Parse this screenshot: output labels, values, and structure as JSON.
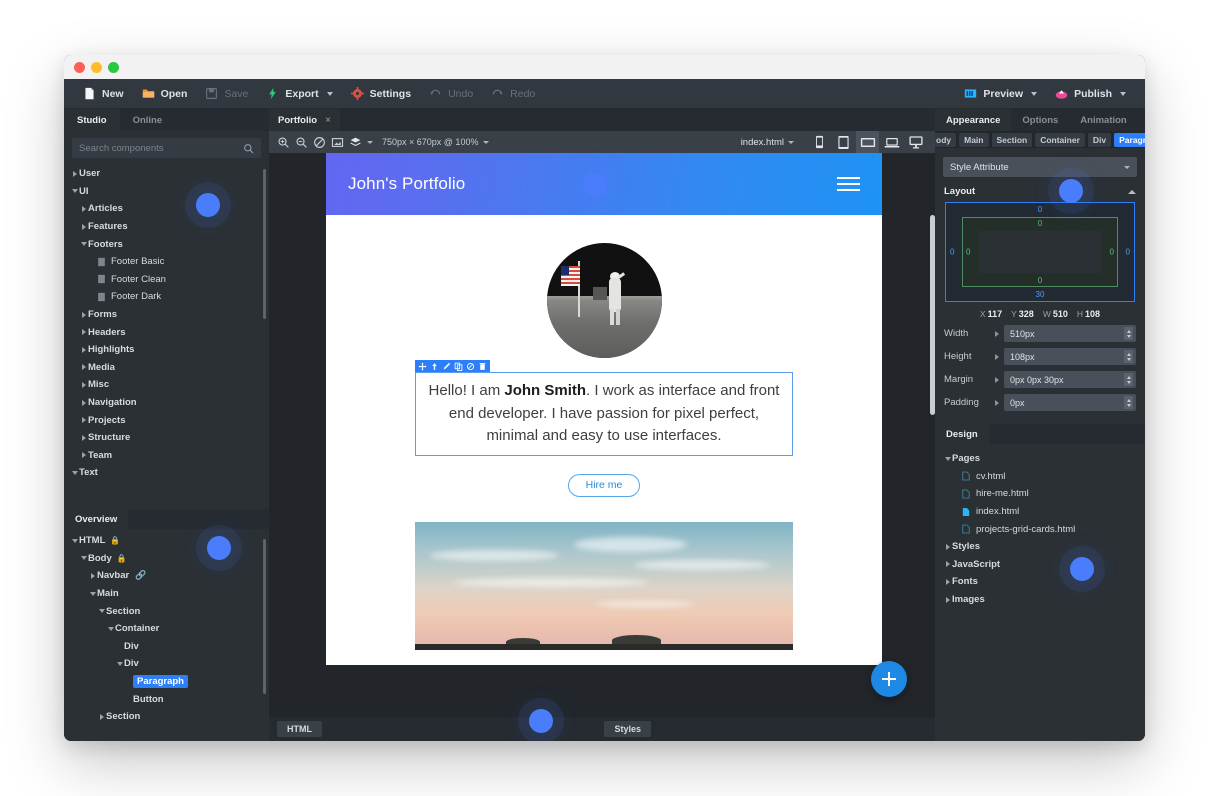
{
  "toolbar": {
    "items": [
      {
        "label": "New",
        "icon": "new-file-icon",
        "disabled": false
      },
      {
        "label": "Open",
        "icon": "open-folder-icon",
        "disabled": false
      },
      {
        "label": "Save",
        "icon": "save-disk-icon",
        "disabled": true
      },
      {
        "label": "Export",
        "icon": "export-bolt-icon",
        "disabled": false,
        "caret": true
      },
      {
        "label": "Settings",
        "icon": "settings-gear-icon",
        "disabled": false
      },
      {
        "label": "Undo",
        "icon": "undo-arrow-icon",
        "disabled": true
      },
      {
        "label": "Redo",
        "icon": "redo-arrow-icon",
        "disabled": true
      }
    ],
    "preview_label": "Preview",
    "publish_label": "Publish"
  },
  "left_panel": {
    "tabs": [
      {
        "label": "Studio",
        "active": true
      },
      {
        "label": "Online",
        "active": false
      }
    ],
    "search": {
      "placeholder": "Search components",
      "value": ""
    },
    "components": [
      {
        "label": "User",
        "depth": 0,
        "twisty": "right",
        "bold": true
      },
      {
        "label": "UI",
        "depth": 0,
        "twisty": "down",
        "bold": true
      },
      {
        "label": "Articles",
        "depth": 1,
        "twisty": "right",
        "bold": true
      },
      {
        "label": "Features",
        "depth": 1,
        "twisty": "right",
        "bold": true
      },
      {
        "label": "Footers",
        "depth": 1,
        "twisty": "down",
        "bold": true
      },
      {
        "label": "Footer Basic",
        "depth": 2,
        "twisty": "none",
        "leaf": true
      },
      {
        "label": "Footer Clean",
        "depth": 2,
        "twisty": "none",
        "leaf": true
      },
      {
        "label": "Footer Dark",
        "depth": 2,
        "twisty": "none",
        "leaf": true
      },
      {
        "label": "Forms",
        "depth": 1,
        "twisty": "right",
        "bold": true
      },
      {
        "label": "Headers",
        "depth": 1,
        "twisty": "right",
        "bold": true
      },
      {
        "label": "Highlights",
        "depth": 1,
        "twisty": "right",
        "bold": true
      },
      {
        "label": "Media",
        "depth": 1,
        "twisty": "right",
        "bold": true
      },
      {
        "label": "Misc",
        "depth": 1,
        "twisty": "right",
        "bold": true
      },
      {
        "label": "Navigation",
        "depth": 1,
        "twisty": "right",
        "bold": true
      },
      {
        "label": "Projects",
        "depth": 1,
        "twisty": "right",
        "bold": true
      },
      {
        "label": "Structure",
        "depth": 1,
        "twisty": "right",
        "bold": true
      },
      {
        "label": "Team",
        "depth": 1,
        "twisty": "right",
        "bold": true
      },
      {
        "label": "Text",
        "depth": 0,
        "twisty": "down",
        "bold": true
      }
    ],
    "overview_tab": "Overview",
    "dom_tree": [
      {
        "label": "HTML",
        "depth": 0,
        "twisty": "down",
        "bold": true,
        "lock": true
      },
      {
        "label": "Body",
        "depth": 1,
        "twisty": "down",
        "bold": true,
        "lock": true
      },
      {
        "label": "Navbar",
        "depth": 2,
        "twisty": "right",
        "bold": true,
        "link": true
      },
      {
        "label": "Main",
        "depth": 2,
        "twisty": "down",
        "bold": true
      },
      {
        "label": "Section",
        "depth": 3,
        "twisty": "down",
        "bold": true
      },
      {
        "label": "Container",
        "depth": 4,
        "twisty": "down",
        "bold": true
      },
      {
        "label": "Div",
        "depth": 5,
        "twisty": "none",
        "bold": true
      },
      {
        "label": "Div",
        "depth": 5,
        "twisty": "down",
        "bold": true
      },
      {
        "label": "Paragraph",
        "depth": 6,
        "twisty": "none",
        "bold": true,
        "selected": true
      },
      {
        "label": "Button",
        "depth": 6,
        "twisty": "none",
        "bold": true
      },
      {
        "label": "Section",
        "depth": 3,
        "twisty": "right",
        "bold": true
      }
    ]
  },
  "center": {
    "doc_tab": {
      "label": "Portfolio",
      "close": "×"
    },
    "canvas_tools": [
      {
        "icon": "zoom-in-icon"
      },
      {
        "icon": "zoom-out-icon"
      },
      {
        "icon": "no-style-icon"
      },
      {
        "icon": "fit-screen-icon"
      },
      {
        "icon": "layers-icon",
        "caret": true
      }
    ],
    "canvas_size_label": "750px × 670px @ 100%",
    "page_select": "index.html",
    "devices": [
      {
        "icon": "phone-icon",
        "active": false
      },
      {
        "icon": "tablet-icon",
        "active": false
      },
      {
        "icon": "small-screen-icon",
        "active": true
      },
      {
        "icon": "laptop-icon",
        "active": false
      },
      {
        "icon": "desktop-icon",
        "active": false
      }
    ],
    "preview": {
      "site_title": "John's Portfolio",
      "paragraph_pre": "Hello! I am ",
      "paragraph_name": "John Smith",
      "paragraph_post": ". I work as interface and front end developer. I have passion for pixel perfect, minimal and easy to use interfaces.",
      "hire_button": "Hire me"
    },
    "selection_toolbar": [
      {
        "icon": "move-icon"
      },
      {
        "icon": "select-parent-arrow-icon"
      },
      {
        "icon": "edit-pencil-icon"
      },
      {
        "icon": "duplicate-icon"
      },
      {
        "icon": "hide-eye-off-icon"
      },
      {
        "icon": "delete-trash-icon"
      }
    ],
    "add_button_icon": "plus-icon",
    "bottom_tabs": [
      {
        "label": "HTML"
      },
      {
        "label": "Styles"
      }
    ]
  },
  "right_panel": {
    "tabs": [
      {
        "label": "Appearance",
        "active": true
      },
      {
        "label": "Options",
        "active": false
      },
      {
        "label": "Animation",
        "active": false
      }
    ],
    "breadcrumb": [
      {
        "label": "ody",
        "selected": false,
        "cut": true
      },
      {
        "label": "Main",
        "selected": false
      },
      {
        "label": "Section",
        "selected": false
      },
      {
        "label": "Container",
        "selected": false
      },
      {
        "label": "Div",
        "selected": false
      },
      {
        "label": "Paragraph",
        "selected": true
      }
    ],
    "style_attribute": "Style Attribute",
    "layout_section": "Layout",
    "box_model": {
      "margin_top": "0",
      "margin_right": "0",
      "margin_bottom": "30",
      "margin_left": "0",
      "padding_top": "0",
      "padding_right": "0",
      "padding_bottom": "0",
      "padding_left": "0"
    },
    "metrics": [
      {
        "label": "X",
        "value": "117"
      },
      {
        "label": "Y",
        "value": "328"
      },
      {
        "label": "W",
        "value": "510"
      },
      {
        "label": "H",
        "value": "108"
      }
    ],
    "properties": [
      {
        "label": "Width",
        "value": "510px"
      },
      {
        "label": "Height",
        "value": "108px"
      },
      {
        "label": "Margin",
        "value": "0px 0px 30px"
      },
      {
        "label": "Padding",
        "value": "0px"
      }
    ],
    "design_tab": "Design",
    "design_tree": [
      {
        "label": "Pages",
        "depth": 0,
        "twisty": "down",
        "bold": true
      },
      {
        "label": "cv.html",
        "depth": 1,
        "twisty": "none",
        "file": true,
        "active": false
      },
      {
        "label": "hire-me.html",
        "depth": 1,
        "twisty": "none",
        "file": true,
        "active": false
      },
      {
        "label": "index.html",
        "depth": 1,
        "twisty": "none",
        "file": true,
        "active": true
      },
      {
        "label": "projects-grid-cards.html",
        "depth": 1,
        "twisty": "none",
        "file": true,
        "active": false
      },
      {
        "label": "Styles",
        "depth": 0,
        "twisty": "right",
        "bold": true
      },
      {
        "label": "JavaScript",
        "depth": 0,
        "twisty": "right",
        "bold": true
      },
      {
        "label": "Fonts",
        "depth": 0,
        "twisty": "right",
        "bold": true
      },
      {
        "label": "Images",
        "depth": 0,
        "twisty": "right",
        "bold": true
      }
    ]
  },
  "colors": {
    "accent_blue": "#2d7ff9",
    "header_gradient_from": "#6366f1",
    "header_gradient_to": "#1e92f5",
    "publish_pink": "#ec4899",
    "panel_bg": "#2b3035"
  }
}
